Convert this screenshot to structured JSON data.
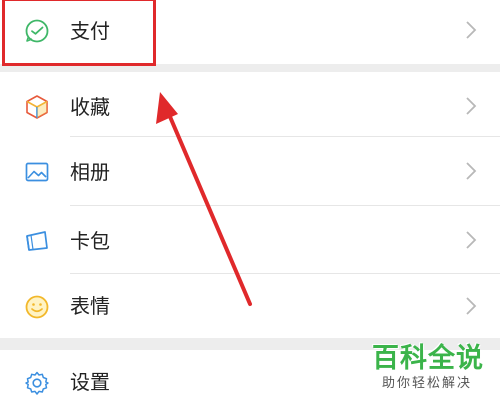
{
  "menu": {
    "items": [
      {
        "label": "支付",
        "icon": "payment-icon"
      },
      {
        "label": "收藏",
        "icon": "favorites-cube-icon"
      },
      {
        "label": "相册",
        "icon": "album-picture-icon"
      },
      {
        "label": "卡包",
        "icon": "card-wallet-icon"
      },
      {
        "label": "表情",
        "icon": "smiley-face-icon"
      },
      {
        "label": "设置",
        "icon": "settings-gear-icon"
      }
    ],
    "chevron_icon": "chevron-right-icon"
  },
  "annotation": {
    "highlight_color": "#e0292b",
    "arrow_color": "#e0292b"
  },
  "watermark": {
    "title": "百科全说",
    "subtitle": "助你轻松解决",
    "color": "#3bb44a"
  },
  "colors": {
    "payment_green": "#3fb768",
    "separator_gray": "#ededed",
    "text": "#222222",
    "chevron": "#b8b8b8"
  }
}
